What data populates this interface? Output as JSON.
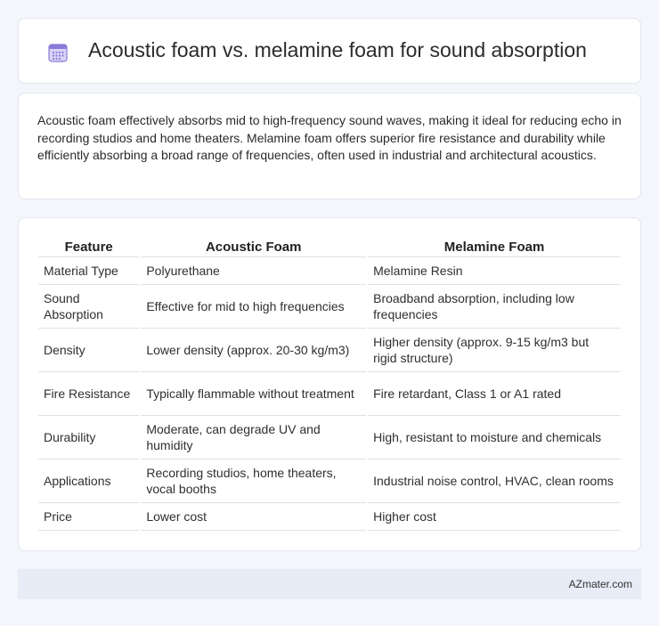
{
  "header": {
    "title": "Acoustic foam vs. melamine foam for sound absorption",
    "icon": "calendar-icon",
    "icon_color": "#8a7bd8"
  },
  "intro": {
    "text": "Acoustic foam effectively absorbs mid to high-frequency sound waves, making it ideal for reducing echo in recording studios and home theaters. Melamine foam offers superior fire resistance and durability while efficiently absorbing a broad range of frequencies, often used in industrial and architectural acoustics."
  },
  "table": {
    "headers": [
      "Feature",
      "Acoustic Foam",
      "Melamine Foam"
    ],
    "rows": [
      [
        "Material Type",
        "Polyurethane",
        "Melamine Resin"
      ],
      [
        "Sound Absorption",
        "Effective for mid to high frequencies",
        "Broadband absorption, including low frequencies"
      ],
      [
        "Density",
        "Lower density (approx. 20-30 kg/m3)",
        "Higher density (approx. 9-15 kg/m3 but rigid structure)"
      ],
      [
        "Fire Resistance",
        "Typically flammable without treatment",
        "Fire retardant, Class 1 or A1 rated"
      ],
      [
        "Durability",
        "Moderate, can degrade UV and humidity",
        "High, resistant to moisture and chemicals"
      ],
      [
        "Applications",
        "Recording studios, home theaters, vocal booths",
        "Industrial noise control, HVAC, clean rooms"
      ],
      [
        "Price",
        "Lower cost",
        "Higher cost"
      ]
    ]
  },
  "footer": {
    "text": "AZmater.com"
  }
}
